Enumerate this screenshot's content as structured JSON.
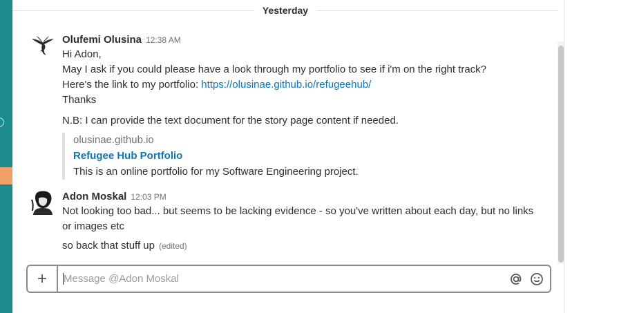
{
  "day_divider": "Yesterday",
  "messages": [
    {
      "sender": "Olufemi Olusina",
      "time": "12:38 AM",
      "lines": [
        "Hi Adon,",
        "May I ask if you could please have a look through my portfolio to see if i'm on the right track?",
        "Here's the link to my portfolio: ",
        "Thanks"
      ],
      "link_text": "https://olusinae.github.io/refugeehub/",
      "followup": "N.B: I can provide the text document for the story page content if needed.",
      "attachment": {
        "service": "olusinae.github.io",
        "title": "Refugee Hub Portfolio",
        "text": "This is an online portfolio for my Software Engineering project."
      }
    },
    {
      "sender": "Adon Moskal",
      "time": "12:03 PM",
      "text": "Not looking too bad... but seems to be lacking evidence - so you've written about each day, but no links or images etc",
      "followup": "so back that stuff up",
      "edited": "(edited)"
    }
  ],
  "composer": {
    "plus_label": "+",
    "placeholder": "Message @Adon Moskal",
    "icons": [
      "at-icon",
      "emoji-icon"
    ]
  },
  "colors": {
    "rail": "#1c8c8e",
    "rail_accent": "#f0a067",
    "link": "#0b77b6"
  }
}
